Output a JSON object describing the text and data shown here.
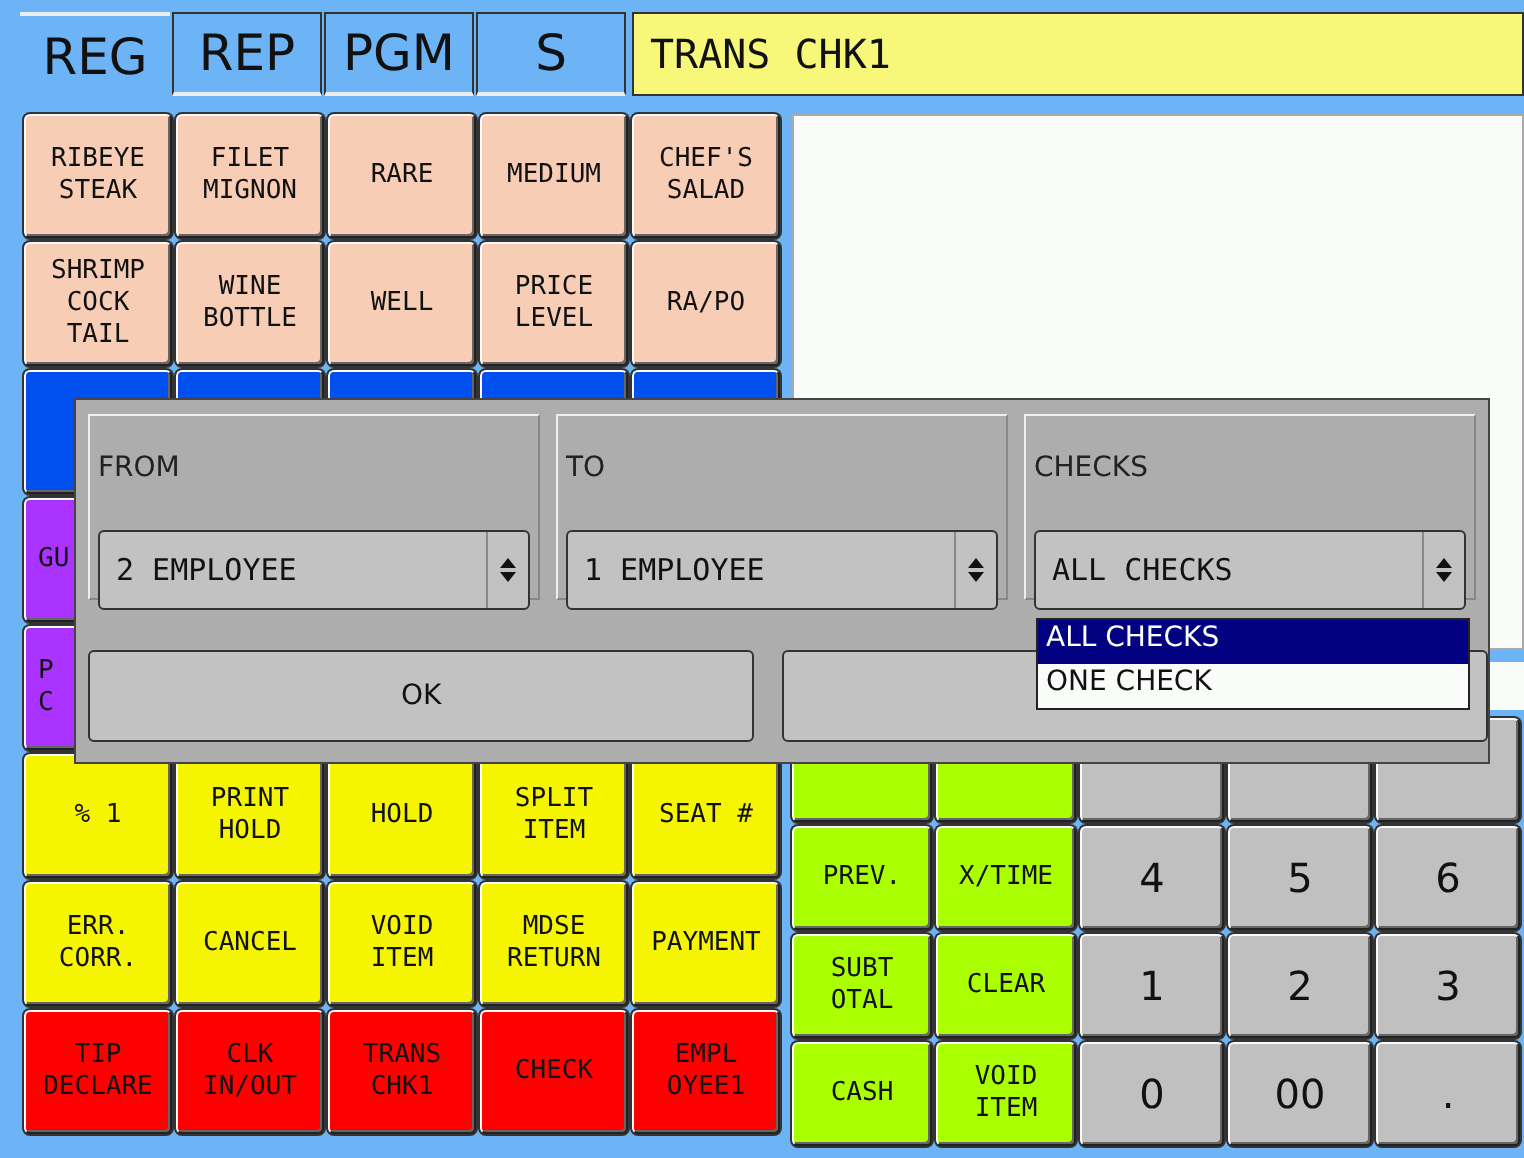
{
  "tabs": [
    {
      "label": "REG",
      "selected": true
    },
    {
      "label": "REP",
      "selected": false
    },
    {
      "label": "PGM",
      "selected": false
    },
    {
      "label": "S",
      "selected": false
    }
  ],
  "title_field": "TRANS CHK1",
  "left_keys": [
    {
      "label": "RIBEYE\nSTEAK",
      "color": "#f7cdb5",
      "kind": "key"
    },
    {
      "label": "FILET\nMIGNON",
      "color": "#f7cdb5",
      "kind": "key"
    },
    {
      "label": "RARE",
      "color": "#f7cdb5",
      "kind": "key"
    },
    {
      "label": "MEDIUM",
      "color": "#f7cdb5",
      "kind": "key"
    },
    {
      "label": "CHEF'S\nSALAD",
      "color": "#f7cdb5",
      "kind": "key"
    },
    {
      "label": "SHRIMP\nCOCK\nTAIL",
      "color": "#f7cdb5",
      "kind": "key"
    },
    {
      "label": "WINE\nBOTTLE",
      "color": "#f7cdb5",
      "kind": "key"
    },
    {
      "label": "WELL",
      "color": "#f7cdb5",
      "kind": "key"
    },
    {
      "label": "PRICE\nLEVEL",
      "color": "#f7cdb5",
      "kind": "key"
    },
    {
      "label": "RA/PO",
      "color": "#f7cdb5",
      "kind": "key"
    },
    {
      "color": "#0050f0",
      "kind": "covered"
    },
    {
      "color": "#0050f0",
      "kind": "covered"
    },
    {
      "color": "#0050f0",
      "kind": "covered"
    },
    {
      "color": "#0050f0",
      "kind": "covered"
    },
    {
      "color": "#0050f0",
      "kind": "covered"
    },
    {
      "label": "GU",
      "color": "#aa33ff",
      "kind": "covered"
    },
    {
      "label": "P\nC",
      "color": "#aa33ff",
      "kind": "covered"
    },
    {
      "label": "% 1",
      "color": "#f5f500",
      "kind": "key"
    },
    {
      "label": "PRINT\nHOLD",
      "color": "#f5f500",
      "kind": "key"
    },
    {
      "label": "HOLD",
      "color": "#f5f500",
      "kind": "key"
    },
    {
      "label": "SPLIT\nITEM",
      "color": "#f5f500",
      "kind": "key"
    },
    {
      "label": "SEAT #",
      "color": "#f5f500",
      "kind": "key"
    },
    {
      "label": "ERR.\nCORR.",
      "color": "#f5f500",
      "kind": "key"
    },
    {
      "label": "CANCEL",
      "color": "#f5f500",
      "kind": "key"
    },
    {
      "label": "VOID\nITEM",
      "color": "#f5f500",
      "kind": "key"
    },
    {
      "label": "MDSE\nRETURN",
      "color": "#f5f500",
      "kind": "key"
    },
    {
      "label": "PAYMENT",
      "color": "#f5f500",
      "kind": "key"
    },
    {
      "label": "TIP\nDECLARE",
      "color": "#ff0000",
      "kind": "key"
    },
    {
      "label": "CLK\nIN/OUT",
      "color": "#ff0000",
      "kind": "key"
    },
    {
      "label": "TRANS\nCHK1",
      "color": "#ff0000",
      "kind": "key"
    },
    {
      "label": "CHECK",
      "color": "#ff0000",
      "kind": "key"
    },
    {
      "label": "EMPL\nOYEE1",
      "color": "#ff0000",
      "kind": "key"
    }
  ],
  "right_keys": [
    {
      "color": "#aaff00",
      "kind": "covered"
    },
    {
      "color": "#aaff00",
      "kind": "covered"
    },
    {
      "color": "#c0c0c0",
      "kind": "covered"
    },
    {
      "color": "#c0c0c0",
      "kind": "covered"
    },
    {
      "color": "#c0c0c0",
      "kind": "covered"
    },
    {
      "label": "PREV.",
      "color": "#aaff00",
      "kind": "key"
    },
    {
      "label": "X/TIME",
      "color": "#aaff00",
      "kind": "key"
    },
    {
      "label": "4",
      "color": "#c0c0c0",
      "kind": "digit"
    },
    {
      "label": "5",
      "color": "#c0c0c0",
      "kind": "digit"
    },
    {
      "label": "6",
      "color": "#c0c0c0",
      "kind": "digit"
    },
    {
      "label": "SUBT\nOTAL",
      "color": "#aaff00",
      "kind": "key"
    },
    {
      "label": "CLEAR",
      "color": "#aaff00",
      "kind": "key"
    },
    {
      "label": "1",
      "color": "#c0c0c0",
      "kind": "digit"
    },
    {
      "label": "2",
      "color": "#c0c0c0",
      "kind": "digit"
    },
    {
      "label": "3",
      "color": "#c0c0c0",
      "kind": "digit"
    },
    {
      "label": "CASH",
      "color": "#aaff00",
      "kind": "key"
    },
    {
      "label": "VOID\nITEM",
      "color": "#aaff00",
      "kind": "key"
    },
    {
      "label": "0",
      "color": "#c0c0c0",
      "kind": "digit"
    },
    {
      "label": "00",
      "color": "#c0c0c0",
      "kind": "digit"
    },
    {
      "label": ".",
      "color": "#c0c0c0",
      "kind": "digit"
    }
  ],
  "dialog": {
    "groups": [
      {
        "label": "FROM",
        "value": "2 EMPLOYEE"
      },
      {
        "label": "TO",
        "value": "1 EMPLOYEE"
      },
      {
        "label": "CHECKS",
        "value": "ALL CHECKS"
      }
    ],
    "open_list": [
      {
        "label": "ALL CHECKS",
        "selected": true
      },
      {
        "label": "ONE CHECK",
        "selected": false
      }
    ],
    "ok_button": "OK"
  }
}
